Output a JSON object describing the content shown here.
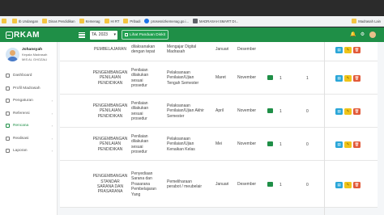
{
  "bookmarks": [
    {
      "label": "",
      "icon": "folder-icon"
    },
    {
      "label": "Ib Undangan",
      "icon": "folder-icon"
    },
    {
      "label": "Dinas Pendidikan",
      "icon": "folder-icon"
    },
    {
      "label": "Kemenag",
      "icon": "folder-icon"
    },
    {
      "label": "HI RT",
      "icon": "folder-icon"
    },
    {
      "label": "Pribadi",
      "icon": "folder-icon"
    },
    {
      "label": "prosesnizkemenag.go.i...",
      "icon": "gov-icon"
    },
    {
      "label": "MADRASAH SMART DI...",
      "icon": "app-icon"
    },
    {
      "label": "Madrasah Lain",
      "icon": "folder-icon"
    }
  ],
  "header": {
    "logo_text": "RKAM",
    "year_select": "TA. 2023",
    "guide_button": "Lihat Panduan Diskit"
  },
  "user": {
    "name": "Johansyah",
    "role": "Kepala Madrasah",
    "school": "MIS AL GHOZALI"
  },
  "sidebar": {
    "items": [
      {
        "label": "Dashboard",
        "icon": "dashboard-icon",
        "chevron": false,
        "active": false
      },
      {
        "label": "Profil Madrasah",
        "icon": "school-icon",
        "chevron": false,
        "active": false
      },
      {
        "label": "Pengaturan",
        "icon": "settings-icon",
        "chevron": true,
        "active": false
      },
      {
        "label": "Referensi",
        "icon": "reference-icon",
        "chevron": true,
        "active": false
      },
      {
        "label": "Rencana",
        "icon": "plan-icon",
        "chevron": true,
        "active": true
      },
      {
        "label": "Realisasi",
        "icon": "realization-icon",
        "chevron": true,
        "active": false
      },
      {
        "label": "Laporan",
        "icon": "report-icon",
        "chevron": true,
        "active": false
      }
    ]
  },
  "table": {
    "rows": [
      {
        "program": [
          "PEMBELAJARAN"
        ],
        "description": [
          "dilaksanakan",
          "dengan tepat"
        ],
        "kegiatan": [
          "Mengajar Digital",
          "Madrasah"
        ],
        "start": "Januari",
        "end": "Desember",
        "n1": "",
        "n2": ""
      },
      {
        "program": [
          "PENGEMBANGAN",
          "PENILAIAN",
          "PENDIDIKAN"
        ],
        "description": [
          "Penilaian",
          "dilakukan",
          "sesuai",
          "prosedur"
        ],
        "kegiatan": [
          "Pelaksanaan",
          "Penilaian/Ujian",
          "Tengah Semester"
        ],
        "start": "Maret",
        "end": "November",
        "n1": "1",
        "n2": "1"
      },
      {
        "program": [
          "PENGEMBANGAN",
          "PENILAIAN",
          "PENDIDIKAN"
        ],
        "description": [
          "Penilaian",
          "dilakukan",
          "sesuai",
          "prosedur"
        ],
        "kegiatan": [
          "Pelaksanaan",
          "Penilaian/Ujian Akhir",
          "Semester"
        ],
        "start": "April",
        "end": "November",
        "n1": "1",
        "n2": "0"
      },
      {
        "program": [
          "PENGEMBANGAN",
          "PENILAIAN",
          "PENDIDIKAN"
        ],
        "description": [
          "Penilaian",
          "dilakukan",
          "sesuai",
          "prosedur"
        ],
        "kegiatan": [
          "Pelaksanaan",
          "Penilaian/Ujian",
          "Kenaikan Kelas"
        ],
        "start": "Mei",
        "end": "November",
        "n1": "1",
        "n2": "0"
      },
      {
        "program": [
          "PENGEMBANGAN",
          "STANDAR",
          "SARANA DAN",
          "PRASARANA"
        ],
        "description": [
          "Penyediaan",
          "Sarana dan",
          "Prasarana",
          "Pembelajaran",
          "Yang"
        ],
        "kegiatan": [
          "Pemeliharaan",
          "perabot / meubelair"
        ],
        "start": "Januari",
        "end": "Desember",
        "n1": "1",
        "n2": "0"
      }
    ]
  }
}
